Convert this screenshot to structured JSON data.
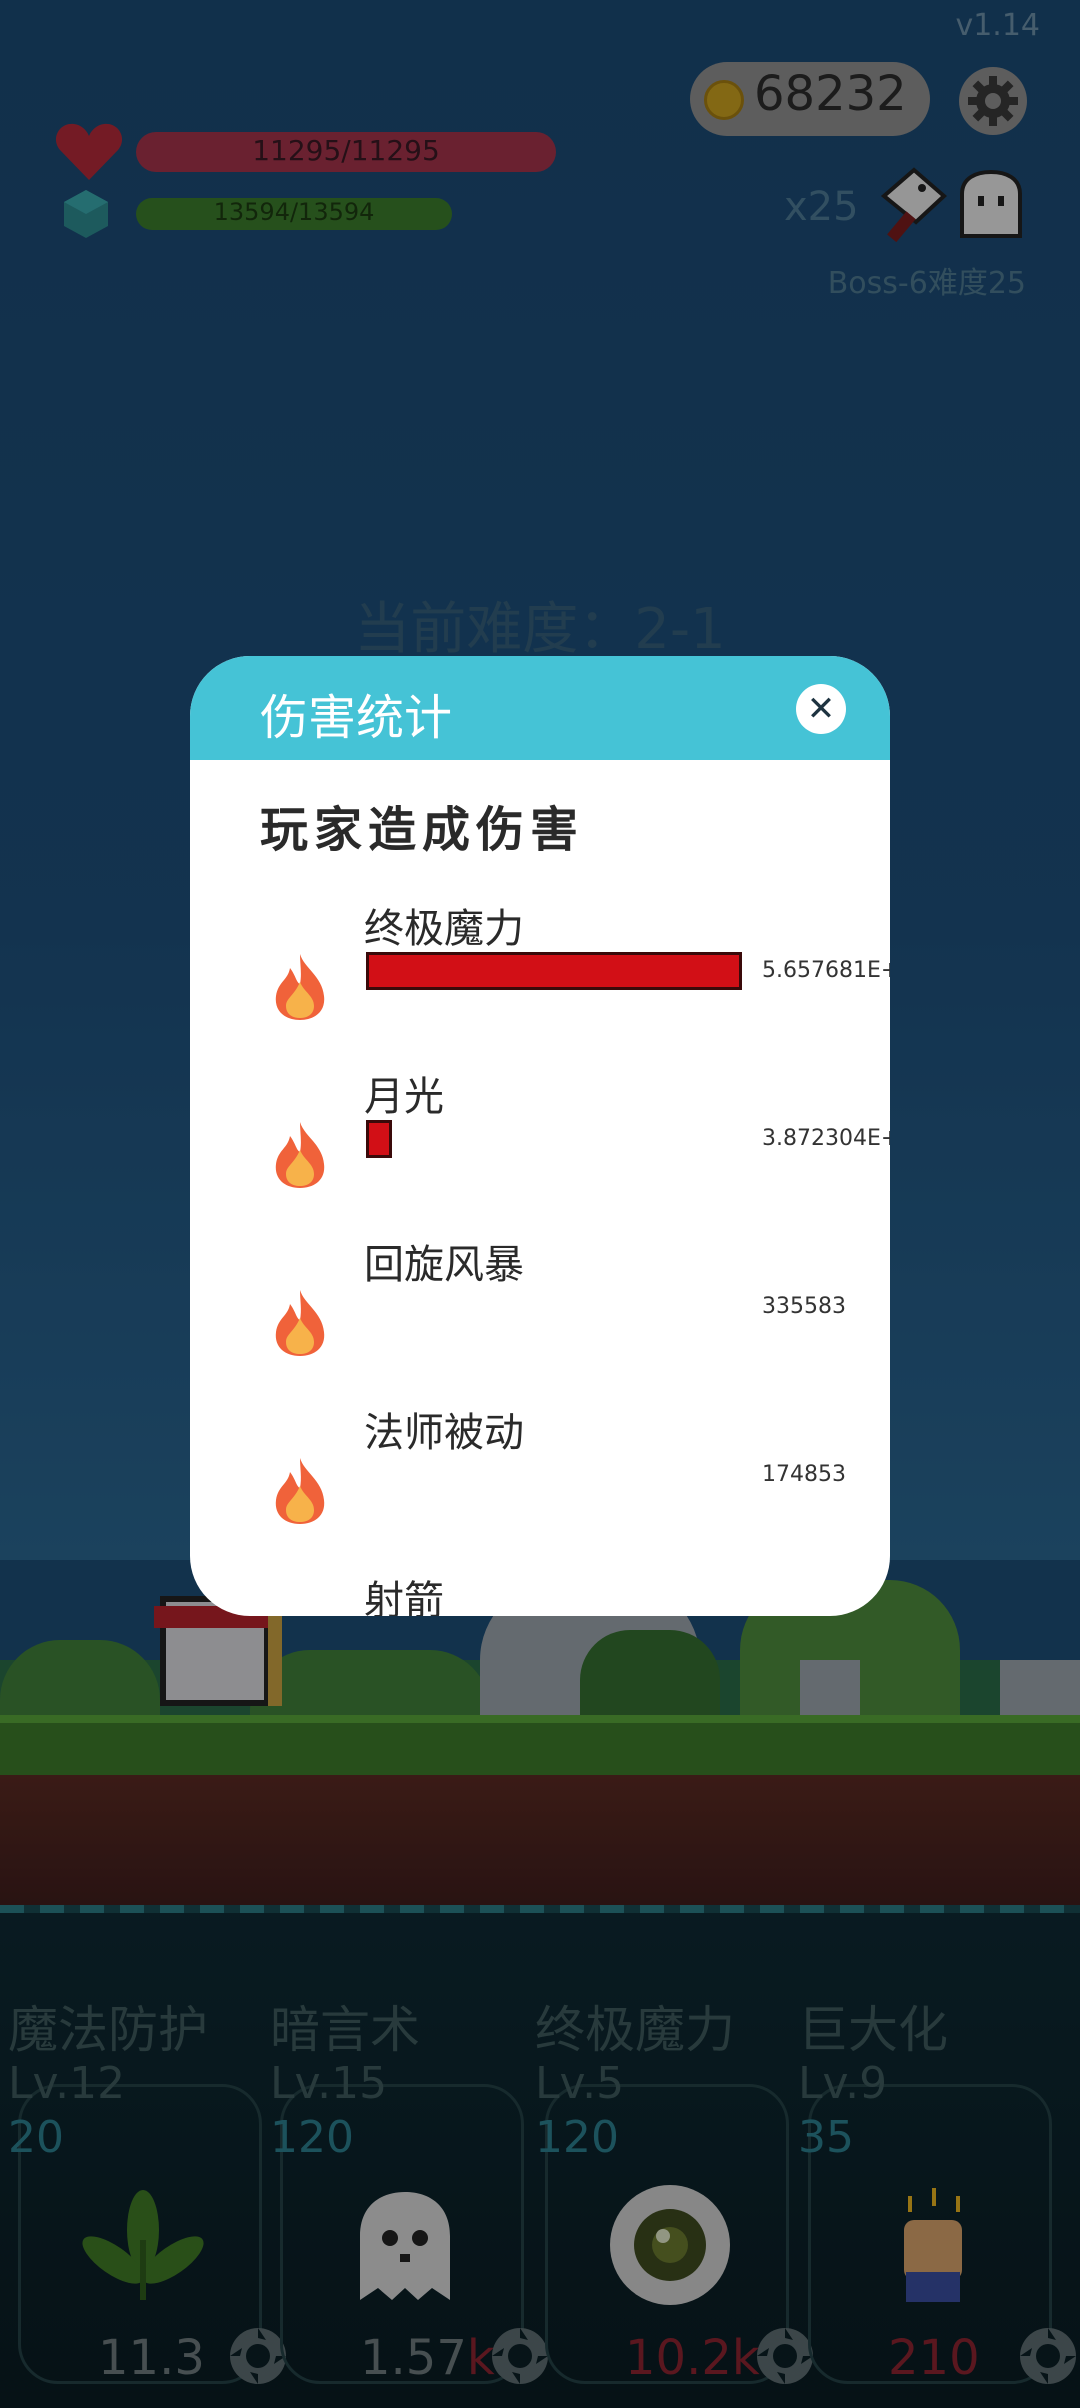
{
  "hud": {
    "version": "v1.14",
    "coins": "68232",
    "hp": "11295/11295",
    "mp": "13594/13594",
    "multiplier": "x25",
    "boss": "Boss-6难度25"
  },
  "difficulty": "当前难度：2-1",
  "dialog": {
    "title": "伤害统计",
    "close_symbol": "✕",
    "section_title": "玩家造成伤害",
    "rows": [
      {
        "name": "终极魔力",
        "value": "5.657681E+",
        "fraction": 1.0
      },
      {
        "name": "月光",
        "value": "3.872304E+",
        "fraction": 0.07
      },
      {
        "name": "回旋风暴",
        "value": "335583",
        "fraction": 0
      },
      {
        "name": "法师被动",
        "value": "174853",
        "fraction": 0
      },
      {
        "name": "射箭",
        "value": "",
        "fraction": 0
      }
    ]
  },
  "skills": [
    {
      "name": "魔法防护",
      "level": "Lv.12",
      "cost": "20",
      "value": "11.3",
      "unit": "",
      "icon": "leaf-icon"
    },
    {
      "name": "暗言术",
      "level": "Lv.15",
      "cost": "120",
      "value": "1.57",
      "unit": "k",
      "icon": "ghost-icon"
    },
    {
      "name": "终极魔力",
      "level": "Lv.5",
      "cost": "120",
      "value": "10.2",
      "unit": "k",
      "icon": "eye-icon"
    },
    {
      "name": "巨大化",
      "level": "Lv.9",
      "cost": "35",
      "value": "210",
      "unit": "",
      "icon": "fist-icon"
    }
  ],
  "colors": {
    "dialog_header": "#45c3d6",
    "damage_bar": "#d20f16",
    "hp_bar": "#a3344b",
    "mp_bar": "#3b7c2c"
  }
}
